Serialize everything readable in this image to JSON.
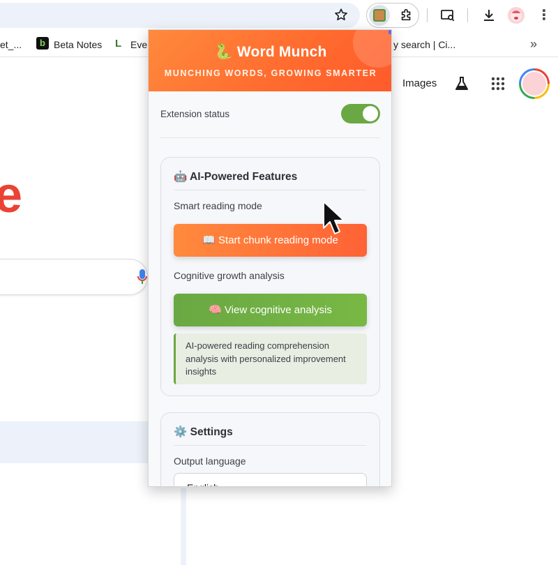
{
  "browser": {
    "bookmarks": [
      {
        "label": "et_..."
      },
      {
        "label": "Beta Notes"
      },
      {
        "label": "Ever"
      },
      {
        "label": "y search | Ci..."
      }
    ]
  },
  "google": {
    "images_link": "Images",
    "logo_fragment": "e"
  },
  "popup": {
    "title": "🐍 Word Munch",
    "subtitle": "MUNCHING WORDS, GROWING SMARTER",
    "status_label": "Extension status",
    "status_enabled": true,
    "ai_card": {
      "title": "🤖 AI-Powered Features",
      "smart_reading_label": "Smart reading mode",
      "chunk_button": "📖 Start chunk reading mode",
      "cognitive_label": "Cognitive growth analysis",
      "analysis_button": "🧠 View cognitive analysis",
      "info_text": "AI-powered reading comprehension analysis with personalized improvement insights"
    },
    "settings_card": {
      "title": "⚙️ Settings",
      "output_language_label": "Output language",
      "output_language_value": "English"
    }
  },
  "colors": {
    "header_orange": "#ff6a2e",
    "toggle_green": "#6aa843",
    "button_green": "#6aa843"
  }
}
